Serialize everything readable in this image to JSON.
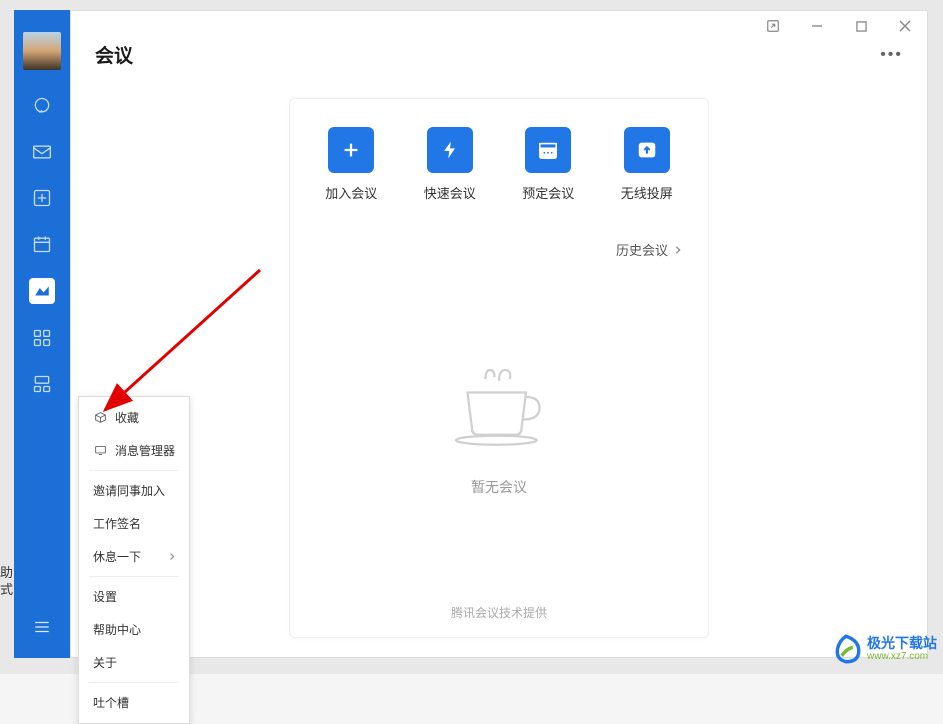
{
  "header": {
    "title": "会议"
  },
  "actions": {
    "join": "加入会议",
    "quick": "快速会议",
    "schedule": "预定会议",
    "cast": "无线投屏"
  },
  "history_link": "历史会议",
  "empty_text": "暂无会议",
  "footer": "腾讯会议技术提供",
  "context_menu": {
    "favorites": "收藏",
    "msg_manager": "消息管理器",
    "invite": "邀请同事加入",
    "signature": "工作签名",
    "rest": "休息一下",
    "settings": "设置",
    "help": "帮助中心",
    "about": "关于",
    "feedback": "吐个槽"
  },
  "watermark": {
    "name": "极光下载站",
    "url": "www.xz7.com"
  },
  "side_labels": {
    "a": "助",
    "b": "式"
  }
}
